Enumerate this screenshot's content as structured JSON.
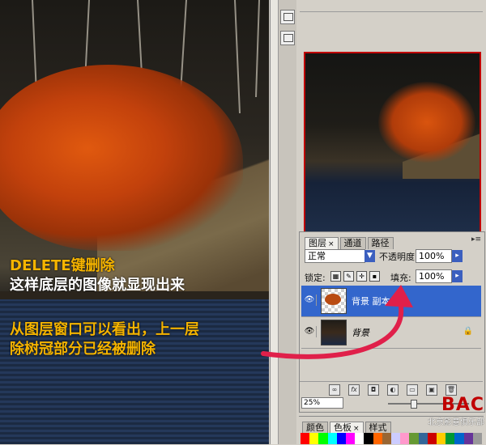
{
  "overlay_text": {
    "line1": "DELETE键删除",
    "line2": "这样底层的图像就显现出来",
    "line3": "从图层窗口可以看出，上一层",
    "line4": "除树冠部分已经被删除"
  },
  "layers_panel": {
    "tabs": [
      "图层",
      "通道",
      "路径"
    ],
    "active_tab": "图层",
    "blend_mode": "正常",
    "opacity_label": "不透明度:",
    "opacity_value": "100%",
    "lock_label": "锁定:",
    "fill_label": "填充:",
    "fill_value": "100%",
    "layers": [
      {
        "name": "背景 副本",
        "selected": true
      },
      {
        "name": "背景",
        "selected": false
      }
    ]
  },
  "zoom_value": "25%",
  "color_panel": {
    "tabs": [
      "颜色",
      "色板",
      "样式"
    ],
    "active_tab": "色板"
  },
  "watermark": {
    "logo": "BAC",
    "subtitle": "北京影意俱乐部"
  },
  "colors": {
    "overlay_yellow": "#f5b400",
    "overlay_white": "#ffffff",
    "selection_blue": "#3366cc",
    "arrow_red": "#e0204a",
    "nav_frame_red": "#c00000"
  },
  "swatches": [
    "#ff0000",
    "#ffff00",
    "#00ff00",
    "#00ffff",
    "#0000ff",
    "#ff00ff",
    "#ffffff",
    "#000000",
    "#ff6600",
    "#996633",
    "#ccccff",
    "#ff99cc",
    "#669933",
    "#336699",
    "#cc0000",
    "#ffcc00",
    "#009933",
    "#0066cc",
    "#663399",
    "#999999"
  ]
}
